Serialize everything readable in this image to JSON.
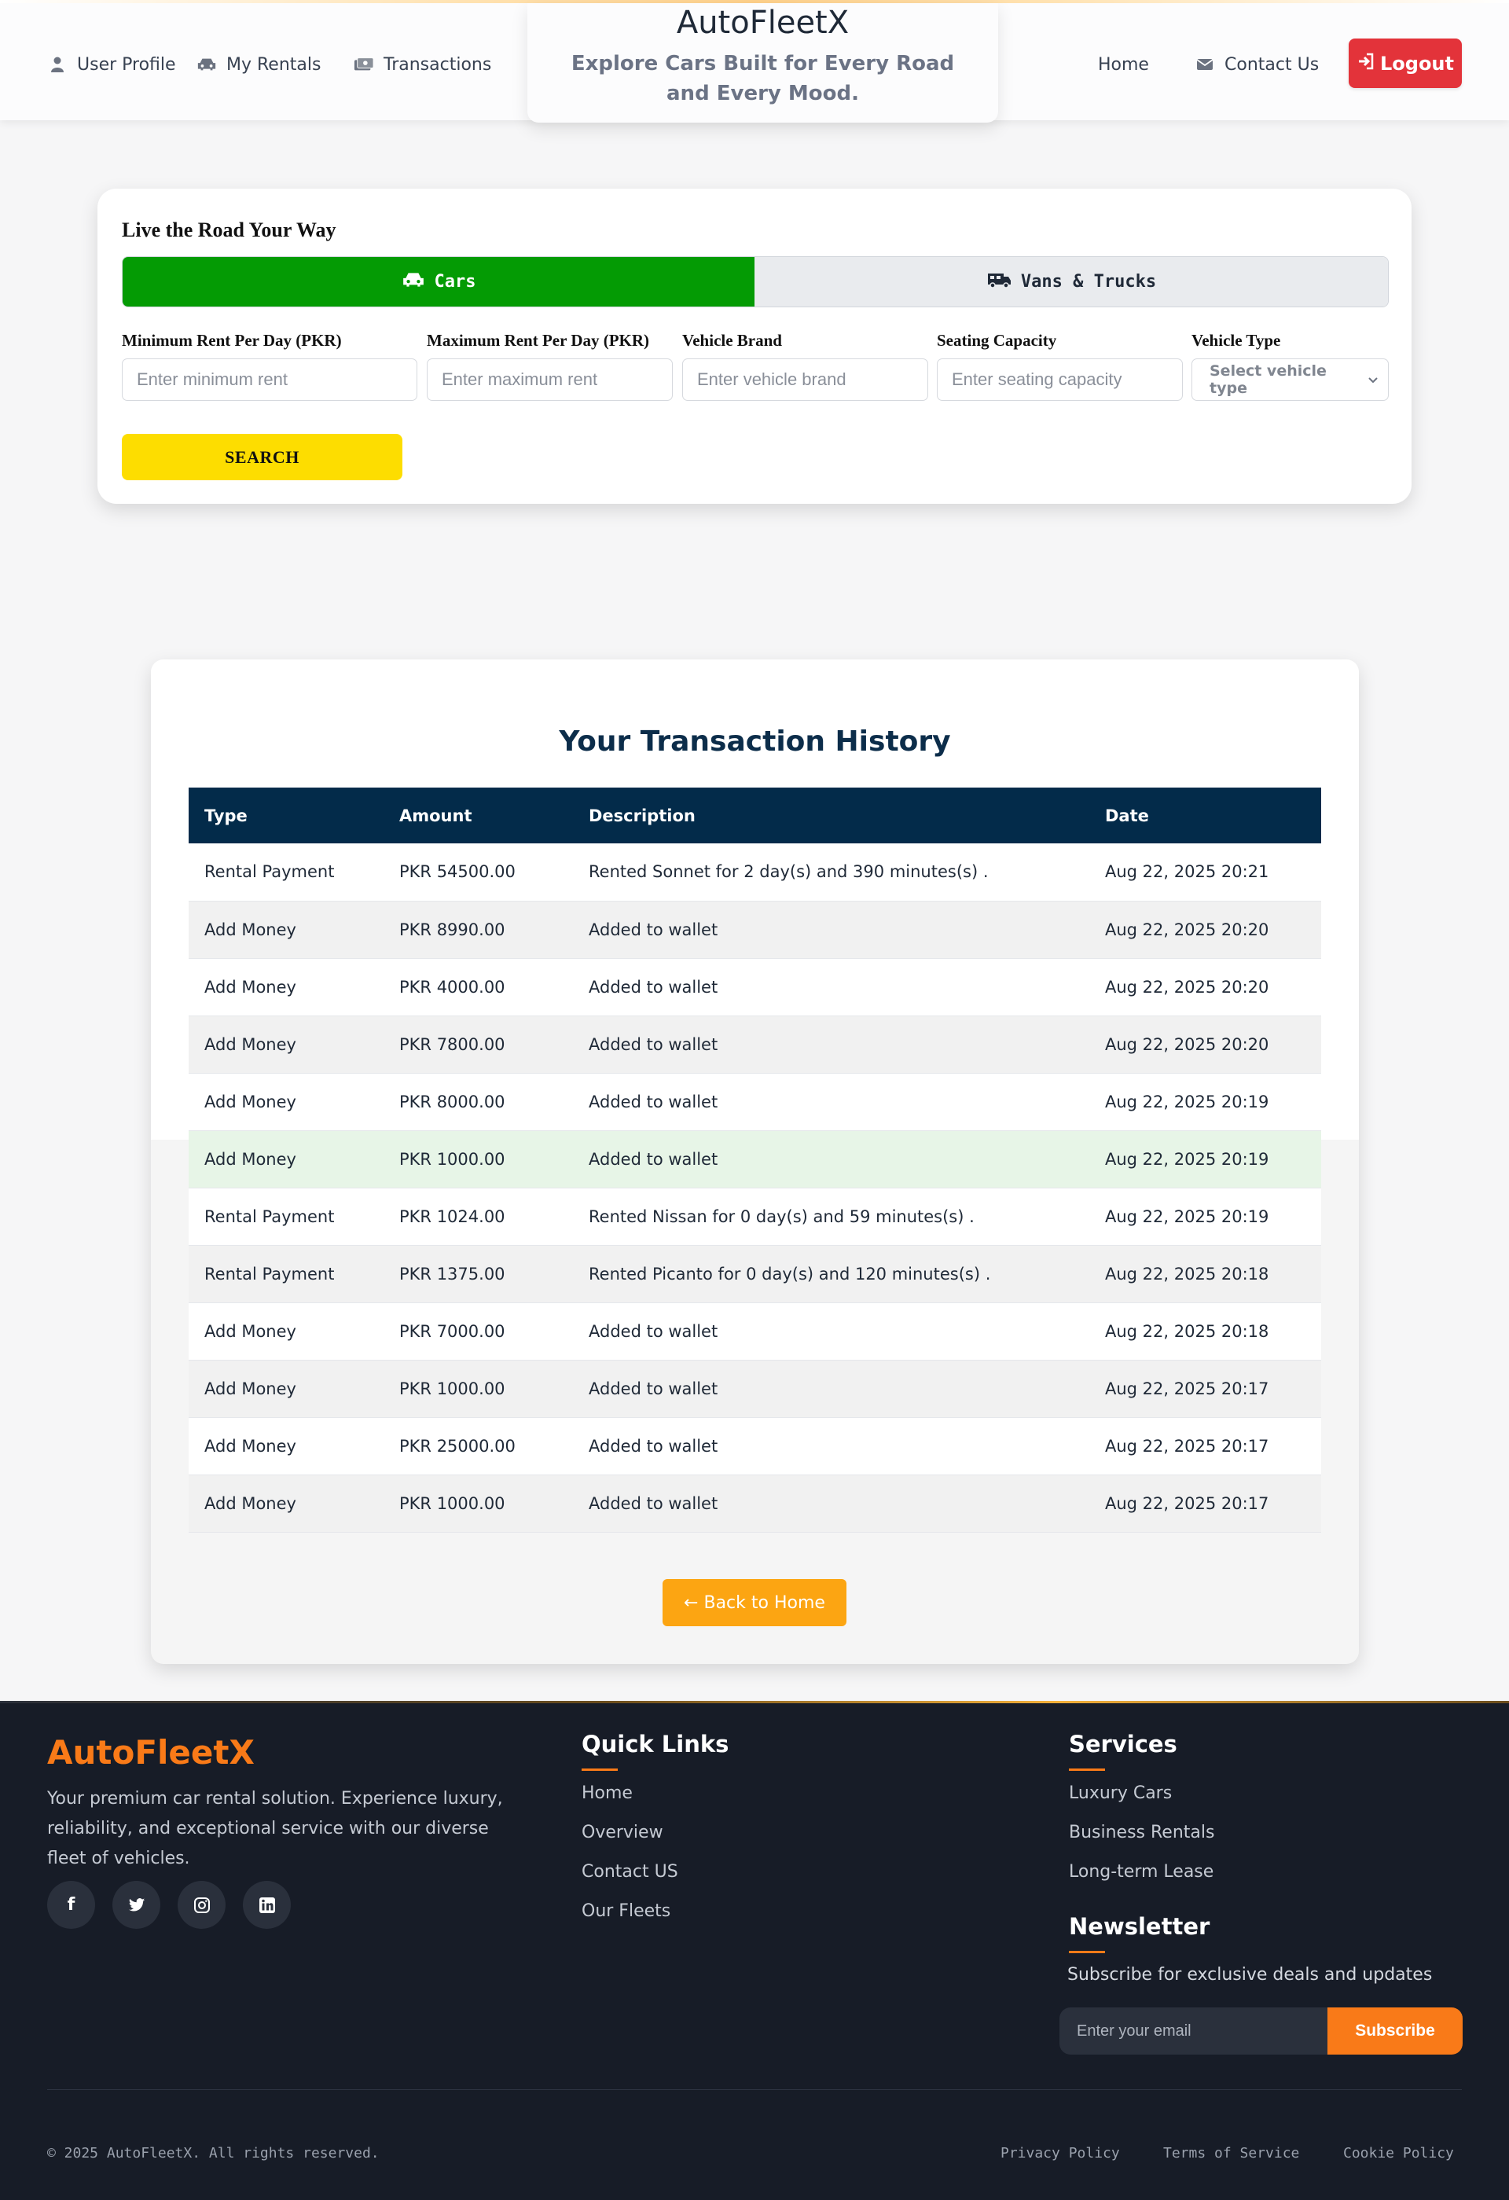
{
  "nav": {
    "left_links": [
      {
        "label": "User Profile",
        "icon": "user-icon"
      },
      {
        "label": "My Rentals",
        "icon": "car-icon"
      },
      {
        "label": "Transactions",
        "icon": "money-icon"
      }
    ],
    "brand": "AutoFleetX",
    "tagline": "Explore Cars Built for Every Road and Every Mood.",
    "right_links": [
      {
        "label": "Home"
      },
      {
        "label": "Contact Us",
        "icon": "envelope-icon"
      }
    ],
    "logout_label": "Logout"
  },
  "search": {
    "heading": "Live the Road Your Way",
    "tabs": [
      {
        "label": "Cars",
        "icon": "car-icon",
        "active": true
      },
      {
        "label": "Vans & Trucks",
        "icon": "truck-icon",
        "active": false
      }
    ],
    "fields": [
      {
        "label": "Minimum Rent Per Day (PKR)",
        "placeholder": "Enter minimum rent"
      },
      {
        "label": "Maximum Rent Per Day (PKR)",
        "placeholder": "Enter maximum rent"
      },
      {
        "label": "Vehicle Brand",
        "placeholder": "Enter vehicle brand"
      },
      {
        "label": "Seating Capacity",
        "placeholder": "Enter seating capacity"
      },
      {
        "label": "Vehicle Type",
        "selected": "Select vehicle type"
      }
    ],
    "button_label": "SEARCH"
  },
  "transactions": {
    "title": "Your Transaction History",
    "columns": [
      "Type",
      "Amount",
      "Description",
      "Date"
    ],
    "rows": [
      {
        "type": "Rental Payment",
        "amount": "PKR 54500.00",
        "description": "Rented Sonnet for 2 day(s) and 390 minutes(s) .",
        "date": "Aug 22, 2025 20:21"
      },
      {
        "type": "Add Money",
        "amount": "PKR 8990.00",
        "description": "Added to wallet",
        "date": "Aug 22, 2025 20:20"
      },
      {
        "type": "Add Money",
        "amount": "PKR 4000.00",
        "description": "Added to wallet",
        "date": "Aug 22, 2025 20:20"
      },
      {
        "type": "Add Money",
        "amount": "PKR 7800.00",
        "description": "Added to wallet",
        "date": "Aug 22, 2025 20:20"
      },
      {
        "type": "Add Money",
        "amount": "PKR 8000.00",
        "description": "Added to wallet",
        "date": "Aug 22, 2025 20:19"
      },
      {
        "type": "Add Money",
        "amount": "PKR 1000.00",
        "description": "Added to wallet",
        "date": "Aug 22, 2025 20:19",
        "highlighted": true
      },
      {
        "type": "Rental Payment",
        "amount": "PKR 1024.00",
        "description": "Rented Nissan for 0 day(s) and 59 minutes(s) .",
        "date": "Aug 22, 2025 20:19"
      },
      {
        "type": "Rental Payment",
        "amount": "PKR 1375.00",
        "description": "Rented Picanto for 0 day(s) and 120 minutes(s) .",
        "date": "Aug 22, 2025 20:18"
      },
      {
        "type": "Add Money",
        "amount": "PKR 7000.00",
        "description": "Added to wallet",
        "date": "Aug 22, 2025 20:18"
      },
      {
        "type": "Add Money",
        "amount": "PKR 1000.00",
        "description": "Added to wallet",
        "date": "Aug 22, 2025 20:17"
      },
      {
        "type": "Add Money",
        "amount": "PKR 25000.00",
        "description": "Added to wallet",
        "date": "Aug 22, 2025 20:17"
      },
      {
        "type": "Add Money",
        "amount": "PKR 1000.00",
        "description": "Added to wallet",
        "date": "Aug 22, 2025 20:17"
      }
    ],
    "back_label": "← Back to Home"
  },
  "footer": {
    "brand": "AutoFleetX",
    "description": "Your premium car rental solution. Experience luxury, reliability, and exceptional service with our diverse fleet of vehicles.",
    "socials": [
      {
        "icon": "facebook-icon",
        "glyph": "f"
      },
      {
        "icon": "twitter-icon",
        "glyph": "🐦"
      },
      {
        "icon": "instagram-icon",
        "glyph": "◎"
      },
      {
        "icon": "linkedin-icon",
        "glyph": "in"
      }
    ],
    "quick_links_heading": "Quick Links",
    "quick_links": [
      "Home",
      "Overview",
      "Contact US",
      "Our Fleets"
    ],
    "services_heading": "Services",
    "services": [
      "Luxury Cars",
      "Business Rentals",
      "Long-term Lease"
    ],
    "newsletter_heading": "Newsletter",
    "newsletter_text": "Subscribe for exclusive deals and updates",
    "email_placeholder": "Enter your email",
    "subscribe_label": "Subscribe",
    "copyright": "© 2025 AutoFleetX. All rights reserved.",
    "legal_links": [
      "Privacy Policy",
      "Terms of Service",
      "Cookie Policy"
    ]
  },
  "colors": {
    "accent_orange": "#f97a18",
    "cars_tab_green": "#049b04",
    "search_yellow": "#fddd00",
    "logout_red": "#e3333a",
    "table_header_navy": "#032b4a",
    "back_button_orange": "#fca512"
  }
}
